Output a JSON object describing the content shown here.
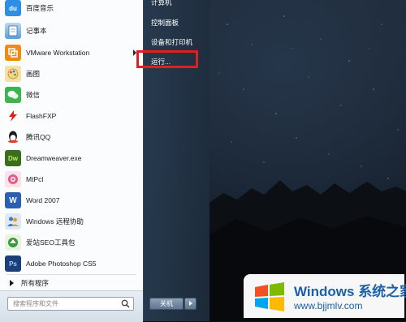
{
  "start_menu": {
    "programs": [
      {
        "label": "百度音乐",
        "icon": "baidu-music-icon",
        "color": "#2d8ee6",
        "glyph": "du"
      },
      {
        "label": "记事本",
        "icon": "notepad-icon",
        "color": "#5aa0d8",
        "glyph": ""
      },
      {
        "label": "VMware Workstation",
        "icon": "vmware-icon",
        "color": "#ef8a19",
        "glyph": ""
      },
      {
        "label": "画图",
        "icon": "paint-icon",
        "color": "#e7b64a",
        "glyph": ""
      },
      {
        "label": "微信",
        "icon": "wechat-icon",
        "color": "#3fb34f",
        "glyph": ""
      },
      {
        "label": "FlashFXP",
        "icon": "flashfxp-icon",
        "color": "#d9261c",
        "glyph": ""
      },
      {
        "label": "腾讯QQ",
        "icon": "qq-icon",
        "color": "#1c1c1c",
        "glyph": ""
      },
      {
        "label": "Dreamweaver.exe",
        "icon": "dreamweaver-icon",
        "color": "#3a6d1d",
        "glyph": "Dw"
      },
      {
        "label": "MtPcl",
        "icon": "mtpcl-icon",
        "color": "#e35a86",
        "glyph": ""
      },
      {
        "label": "Word 2007",
        "icon": "word-icon",
        "color": "#2b5fb4",
        "glyph": "W"
      },
      {
        "label": "Windows 远程协助",
        "icon": "remote-assist-icon",
        "color": "#3a78c8",
        "glyph": ""
      },
      {
        "label": "爱站SEO工具包",
        "icon": "aizhan-seo-icon",
        "color": "#3a9a3a",
        "glyph": ""
      },
      {
        "label": "Adobe Photoshop CS5",
        "icon": "photoshop-icon",
        "color": "#1d3f78",
        "glyph": "Ps"
      }
    ],
    "all_programs": "所有程序",
    "search_placeholder": "搜索程序和文件",
    "right_items": {
      "computer": "计算机",
      "control_panel": "控制面板",
      "devices_printers": "设备和打印机",
      "run": "运行..."
    },
    "shutdown_label": "关机"
  },
  "watermark": {
    "brand": "Windows",
    "brand_cn": "系统之家",
    "url": "www.bjjmlv.com"
  }
}
